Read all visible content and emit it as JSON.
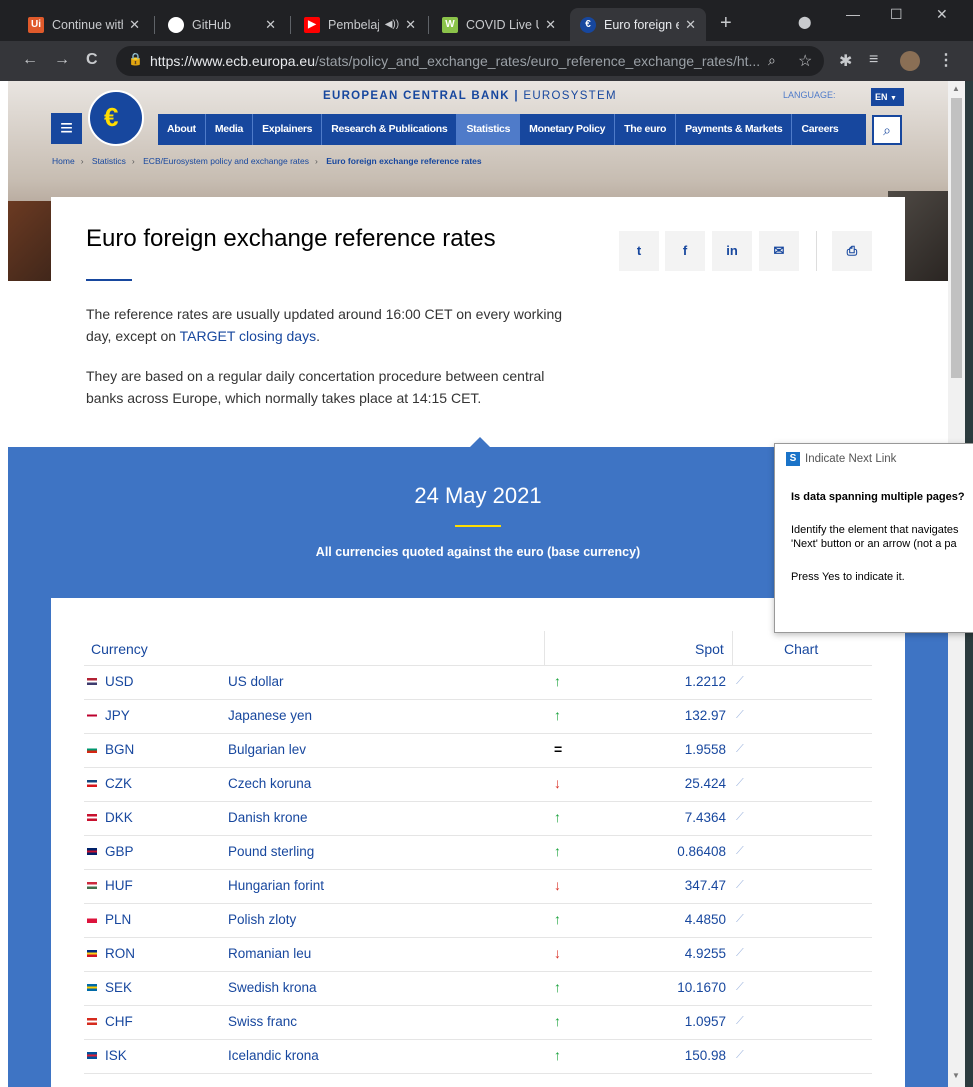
{
  "browser": {
    "tabs": [
      {
        "title": "Continue with",
        "favicon": "uipath-icon",
        "fav_color": "#e05a2b",
        "fav_text": "Ui"
      },
      {
        "title": "GitHub",
        "favicon": "github-icon",
        "fav_color": "#ffffff",
        "fav_text": ""
      },
      {
        "title": "Pembelaj",
        "favicon": "youtube-icon",
        "fav_color": "#ff0000",
        "fav_text": "▶"
      },
      {
        "title": "COVID Live Up",
        "favicon": "worldometer-icon",
        "fav_color": "#8bc34a",
        "fav_text": "W"
      },
      {
        "title": "Euro foreign e",
        "favicon": "ecb-icon",
        "fav_color": "#17479e",
        "fav_text": "€"
      }
    ],
    "url_host": "https://www.ecb.europa.eu",
    "url_path": "/stats/policy_and_exchange_rates/euro_reference_exchange_rates/ht..."
  },
  "site": {
    "header_title": "EUROPEAN CENTRAL BANK",
    "header_sub": "EUROSYSTEM",
    "language_label": "LANGUAGE:",
    "language_value": "EN",
    "nav": [
      "About",
      "Media",
      "Explainers",
      "Research & Publications",
      "Statistics",
      "Monetary Policy",
      "The euro",
      "Payments & Markets",
      "Careers"
    ],
    "breadcrumb": [
      "Home",
      "Statistics",
      "ECB/Eurosystem policy and exchange rates",
      "Euro foreign exchange reference rates"
    ]
  },
  "content": {
    "title": "Euro foreign exchange reference rates",
    "para1_pre": "The reference rates are usually updated around 16:00 CET on every working day, except on ",
    "para1_link": "TARGET closing days",
    "para1_post": ".",
    "para2": "They are based on a regular daily concertation procedure between central banks across Europe, which normally takes place at 14:15 CET.",
    "share": [
      "twitter-icon",
      "facebook-icon",
      "linkedin-icon",
      "email-icon",
      "print-icon"
    ]
  },
  "rates": {
    "date": "24 May 2021",
    "subtitle": "All currencies quoted against the euro (base currency)",
    "col_currency": "Currency",
    "col_spot": "Spot",
    "col_chart": "Chart",
    "rows": [
      {
        "code": "USD",
        "name": "US dollar",
        "trend": "up",
        "spot": "1.2212",
        "flag": [
          "#b22234",
          "#ffffff",
          "#3c3b6e"
        ]
      },
      {
        "code": "JPY",
        "name": "Japanese yen",
        "trend": "up",
        "spot": "132.97",
        "flag": [
          "#ffffff",
          "#bc002d",
          "#ffffff"
        ]
      },
      {
        "code": "BGN",
        "name": "Bulgarian lev",
        "trend": "eq",
        "spot": "1.9558",
        "flag": [
          "#ffffff",
          "#00966e",
          "#d62612"
        ]
      },
      {
        "code": "CZK",
        "name": "Czech koruna",
        "trend": "down",
        "spot": "25.424",
        "flag": [
          "#11457e",
          "#ffffff",
          "#d7141a"
        ]
      },
      {
        "code": "DKK",
        "name": "Danish krone",
        "trend": "up",
        "spot": "7.4364",
        "flag": [
          "#c8102e",
          "#ffffff",
          "#c8102e"
        ]
      },
      {
        "code": "GBP",
        "name": "Pound sterling",
        "trend": "up",
        "spot": "0.86408",
        "flag": [
          "#012169",
          "#c8102e",
          "#012169"
        ]
      },
      {
        "code": "HUF",
        "name": "Hungarian forint",
        "trend": "down",
        "spot": "347.47",
        "flag": [
          "#cd2a3e",
          "#ffffff",
          "#436f4d"
        ]
      },
      {
        "code": "PLN",
        "name": "Polish zloty",
        "trend": "up",
        "spot": "4.4850",
        "flag": [
          "#ffffff",
          "#dc143c",
          "#dc143c"
        ]
      },
      {
        "code": "RON",
        "name": "Romanian leu",
        "trend": "down",
        "spot": "4.9255",
        "flag": [
          "#002b7f",
          "#fcd116",
          "#ce1126"
        ]
      },
      {
        "code": "SEK",
        "name": "Swedish krona",
        "trend": "up",
        "spot": "10.1670",
        "flag": [
          "#006aa7",
          "#fecc00",
          "#006aa7"
        ]
      },
      {
        "code": "CHF",
        "name": "Swiss franc",
        "trend": "up",
        "spot": "1.0957",
        "flag": [
          "#d52b1e",
          "#ffffff",
          "#d52b1e"
        ]
      },
      {
        "code": "ISK",
        "name": "Icelandic krona",
        "trend": "up",
        "spot": "150.98",
        "flag": [
          "#02529c",
          "#dc1e35",
          "#02529c"
        ]
      }
    ]
  },
  "popup": {
    "title": "Indicate Next Link",
    "question": "Is data spanning multiple pages?",
    "text1": "Identify the element that navigates",
    "text2": "'Next' button or an arrow (not a pa",
    "text3": "Press Yes to indicate it."
  },
  "colors": {
    "brand": "#17479e",
    "band": "#3e74c4",
    "up": "#1aa33c",
    "down": "#d93025"
  }
}
